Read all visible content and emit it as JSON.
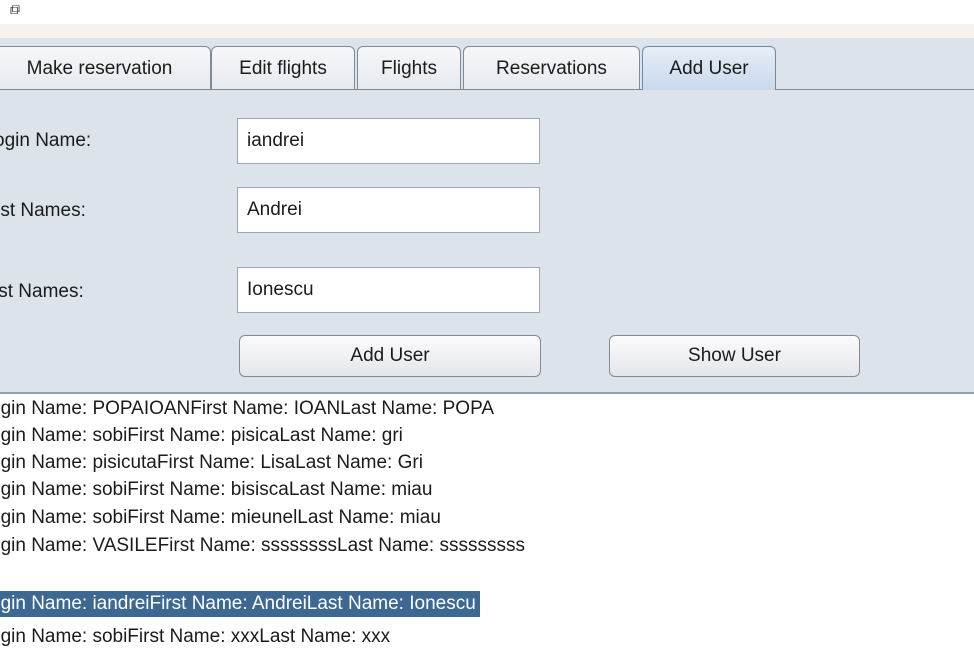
{
  "window": {
    "corner_glyph": "⧉"
  },
  "tabs": [
    {
      "label": "Make reservation",
      "active": false
    },
    {
      "label": "Edit flights",
      "active": false
    },
    {
      "label": "Flights",
      "active": false
    },
    {
      "label": "Reservations",
      "active": false
    },
    {
      "label": "Add User",
      "active": true
    }
  ],
  "form": {
    "login_label": "ogin Name:",
    "login_value": "iandrei",
    "first_label": "rst Names:",
    "first_value": "Andrei",
    "last_label": "ist Names:",
    "last_value": "Ionescu",
    "add_button": "Add User",
    "show_button": "Show User"
  },
  "users": [
    {
      "text": "ogin Name: POPAIOANFirst Name:  IOANLast Name: POPA",
      "selected": false
    },
    {
      "text": "ogin Name: sobiFirst Name:  pisicaLast Name: gri",
      "selected": false
    },
    {
      "text": "ogin Name: pisicutaFirst Name:  LisaLast Name: Gri",
      "selected": false
    },
    {
      "text": "ogin Name: sobiFirst Name:  bisiscaLast Name: miau",
      "selected": false
    },
    {
      "text": "ogin Name: sobiFirst Name:  mieunelLast Name: miau",
      "selected": false
    },
    {
      "text": "ogin Name: VASILEFirst Name:  ssssssssLast Name: sssssssss",
      "selected": false
    },
    {
      "text": "ogin Name: iandreiFirst Name:  AndreiLast Name: Ionescu",
      "selected": true
    },
    {
      "text": "ogin Name: sobiFirst Name:  xxxLast Name: xxx",
      "selected": false
    }
  ],
  "colors": {
    "panel_bg": "#dde3ea",
    "active_tab": "#c9d9ec",
    "selection": "#3d6891",
    "panel_border": "#8aa1bb"
  },
  "icons": {
    "corner": "window-restore-icon"
  }
}
